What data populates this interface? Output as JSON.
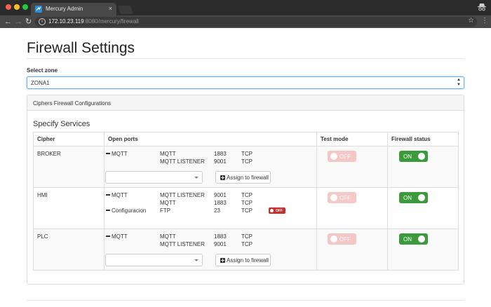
{
  "browser": {
    "tab_title": "Mercury Admin",
    "tab_close": "×",
    "url_host": "172.10.23.119",
    "url_rest": ":8080/mercury/firewall"
  },
  "page": {
    "title": "Firewall Settings",
    "zone_label": "Select zone",
    "zone_value": "ZONA1"
  },
  "panel": {
    "heading": "Ciphers Firewall Configurations",
    "section_title": "Specify Services",
    "columns": [
      "Cipher",
      "Open ports",
      "Test mode",
      "Firewall status"
    ],
    "assign_label": "Assign to firewall",
    "mini_off_label": "OFF",
    "rows": [
      {
        "cipher": "BROKER",
        "ports": [
          {
            "name": "MQTT",
            "service": "MQTT",
            "port": "1883",
            "proto": "TCP"
          },
          {
            "name": "",
            "service": "MQTT LISTENER",
            "port": "9001",
            "proto": "TCP"
          }
        ],
        "test_mode": "OFF",
        "firewall_status": "ON"
      },
      {
        "cipher": "HMI",
        "ports": [
          {
            "name": "MQTT",
            "service": "MQTT LISTENER",
            "port": "9001",
            "proto": "TCP"
          },
          {
            "name": "",
            "service": "MQTT",
            "port": "1883",
            "proto": "TCP"
          },
          {
            "name": "Configuracion",
            "service": "FTP",
            "port": "23",
            "proto": "TCP",
            "status": "OFF"
          }
        ],
        "test_mode": "OFF",
        "firewall_status": "ON"
      },
      {
        "cipher": "PLC",
        "ports": [
          {
            "name": "MQTT",
            "service": "MQTT",
            "port": "1883",
            "proto": "TCP"
          },
          {
            "name": "",
            "service": "MQTT LISTENER",
            "port": "9001",
            "proto": "TCP"
          }
        ],
        "test_mode": "OFF",
        "firewall_status": "ON"
      }
    ]
  },
  "colors": {
    "toggle_on": "#3c9a3c",
    "toggle_off_disabled": "#f2b7b5",
    "mini_off": "#c9302c",
    "focus_border": "#66afe9"
  }
}
